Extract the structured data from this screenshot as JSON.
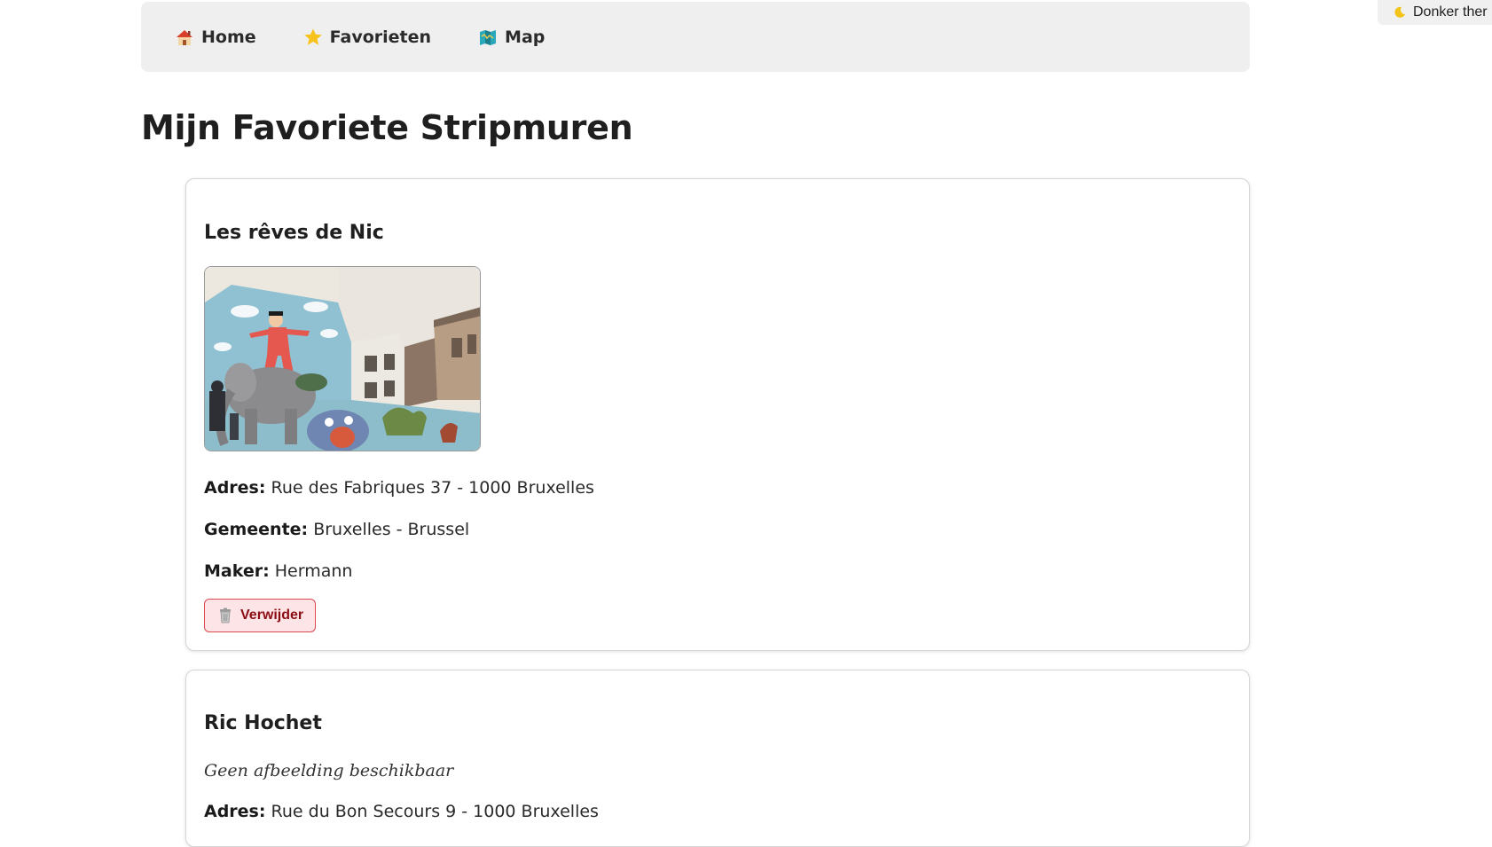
{
  "theme_toggle": {
    "label": "Donker ther",
    "icon": "moon-icon"
  },
  "nav": {
    "items": [
      {
        "label": "Home",
        "icon": "house-icon"
      },
      {
        "label": "Favorieten",
        "icon": "star-icon"
      },
      {
        "label": "Map",
        "icon": "map-icon"
      }
    ]
  },
  "page": {
    "title": "Mijn Favoriete Stripmuren"
  },
  "favorites": [
    {
      "title": "Les rêves de Nic",
      "image": "mural-photo",
      "adres_label": "Adres:",
      "adres": "Rue des Fabriques 37 - 1000 Bruxelles",
      "gemeente_label": "Gemeente:",
      "gemeente": "Bruxelles - Brussel",
      "maker_label": "Maker:",
      "maker": "Hermann",
      "delete_label": "Verwijder"
    },
    {
      "title": "Ric Hochet",
      "no_image_text": "Geen afbeelding beschikbaar",
      "adres_label": "Adres:",
      "adres": "Rue du Bon Secours 9 - 1000 Bruxelles"
    }
  ],
  "colors": {
    "navbar_bg": "#efefef",
    "delete_bg": "#fde4e6",
    "delete_border": "#d9474f",
    "delete_text": "#8b0d14"
  }
}
